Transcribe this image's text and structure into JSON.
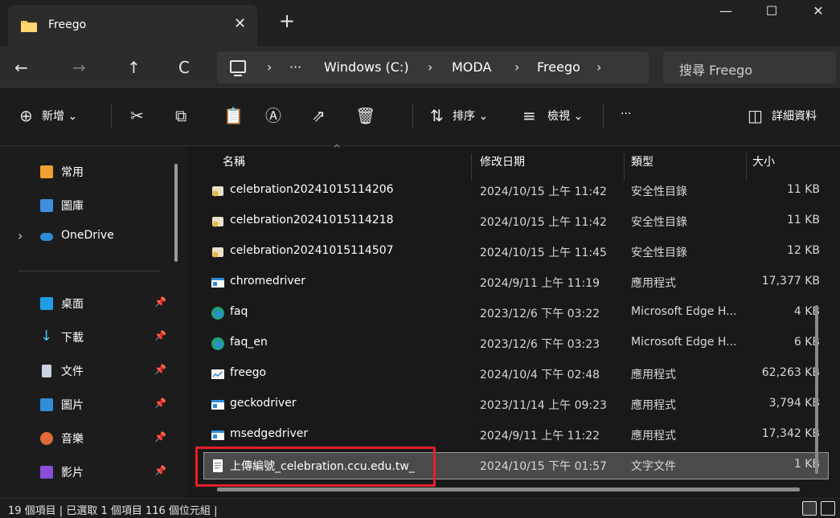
{
  "window": {
    "tab_title": "Freego",
    "tab_close": "✕",
    "new_tab": "+",
    "minimize": "—",
    "maximize": "☐",
    "close": "✕"
  },
  "address": {
    "back": "←",
    "forward": "→",
    "up": "↑",
    "refresh": "C",
    "sep": "›",
    "more": "···",
    "crumbs": [
      "Windows (C:)",
      "MODA",
      "Freego"
    ],
    "search_placeholder": "搜尋 Freego"
  },
  "commands": {
    "new_label": "新增",
    "sort_label": "排序",
    "view_label": "檢視",
    "more": "···",
    "details_label": "詳細資料",
    "chev": "⌄"
  },
  "sidebar": {
    "items": [
      {
        "label": "常用",
        "icon": "home-icon"
      },
      {
        "label": "圖庫",
        "icon": "gallery-icon"
      },
      {
        "label": "OneDrive",
        "icon": "cloud-icon"
      },
      {
        "label": "桌面",
        "icon": "desktop-icon",
        "pinned": true
      },
      {
        "label": "下載",
        "icon": "download-icon",
        "pinned": true
      },
      {
        "label": "文件",
        "icon": "document-icon",
        "pinned": true
      },
      {
        "label": "圖片",
        "icon": "pictures-icon",
        "pinned": true
      },
      {
        "label": "音樂",
        "icon": "music-icon",
        "pinned": true
      },
      {
        "label": "影片",
        "icon": "video-icon",
        "pinned": true
      }
    ],
    "expand": "›",
    "pin": "📌"
  },
  "columns": [
    "名稱",
    "修改日期",
    "類型",
    "大小"
  ],
  "files": [
    {
      "name": "celebration20241015114206",
      "date": "2024/10/15 上午 11:42",
      "type": "安全性目錄",
      "size": "11 KB",
      "icon": "certificate-icon"
    },
    {
      "name": "celebration20241015114218",
      "date": "2024/10/15 上午 11:42",
      "type": "安全性目錄",
      "size": "11 KB",
      "icon": "certificate-icon"
    },
    {
      "name": "celebration20241015114507",
      "date": "2024/10/15 上午 11:45",
      "type": "安全性目錄",
      "size": "12 KB",
      "icon": "certificate-icon"
    },
    {
      "name": "chromedriver",
      "date": "2024/9/11 上午 11:19",
      "type": "應用程式",
      "size": "17,377 KB",
      "icon": "app-icon"
    },
    {
      "name": "faq",
      "date": "2023/12/6 下午 03:22",
      "type": "Microsoft Edge H...",
      "size": "4 KB",
      "icon": "edge-icon"
    },
    {
      "name": "faq_en",
      "date": "2023/12/6 下午 03:23",
      "type": "Microsoft Edge H...",
      "size": "6 KB",
      "icon": "edge-icon"
    },
    {
      "name": "freego",
      "date": "2024/10/4 下午 02:48",
      "type": "應用程式",
      "size": "62,263 KB",
      "icon": "freego-app-icon"
    },
    {
      "name": "geckodriver",
      "date": "2023/11/14 上午 09:23",
      "type": "應用程式",
      "size": "3,794 KB",
      "icon": "app-icon"
    },
    {
      "name": "msedgedriver",
      "date": "2024/9/11 上午 11:22",
      "type": "應用程式",
      "size": "17,342 KB",
      "icon": "app-icon"
    },
    {
      "name": "上傳編號_celebration.ccu.edu.tw_",
      "date": "2024/10/15 下午 01:57",
      "type": "文字文件",
      "size": "1 KB",
      "icon": "text-file-icon",
      "selected": true
    }
  ],
  "status": "19 個項目  |  已選取 1 個項目  116 個位元組  |",
  "colors": {
    "highlight": "#e5202a",
    "accent": "#4cc2ff"
  }
}
